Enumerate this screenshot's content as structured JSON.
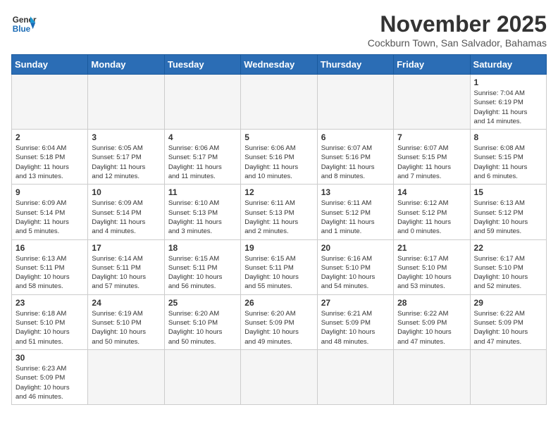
{
  "header": {
    "logo_line1": "General",
    "logo_line2": "Blue",
    "title": "November 2025",
    "subtitle": "Cockburn Town, San Salvador, Bahamas"
  },
  "days_of_week": [
    "Sunday",
    "Monday",
    "Tuesday",
    "Wednesday",
    "Thursday",
    "Friday",
    "Saturday"
  ],
  "weeks": [
    [
      {
        "day": "",
        "info": ""
      },
      {
        "day": "",
        "info": ""
      },
      {
        "day": "",
        "info": ""
      },
      {
        "day": "",
        "info": ""
      },
      {
        "day": "",
        "info": ""
      },
      {
        "day": "",
        "info": ""
      },
      {
        "day": "1",
        "info": "Sunrise: 7:04 AM\nSunset: 6:19 PM\nDaylight: 11 hours\nand 14 minutes."
      }
    ],
    [
      {
        "day": "2",
        "info": "Sunrise: 6:04 AM\nSunset: 5:18 PM\nDaylight: 11 hours\nand 13 minutes."
      },
      {
        "day": "3",
        "info": "Sunrise: 6:05 AM\nSunset: 5:17 PM\nDaylight: 11 hours\nand 12 minutes."
      },
      {
        "day": "4",
        "info": "Sunrise: 6:06 AM\nSunset: 5:17 PM\nDaylight: 11 hours\nand 11 minutes."
      },
      {
        "day": "5",
        "info": "Sunrise: 6:06 AM\nSunset: 5:16 PM\nDaylight: 11 hours\nand 10 minutes."
      },
      {
        "day": "6",
        "info": "Sunrise: 6:07 AM\nSunset: 5:16 PM\nDaylight: 11 hours\nand 8 minutes."
      },
      {
        "day": "7",
        "info": "Sunrise: 6:07 AM\nSunset: 5:15 PM\nDaylight: 11 hours\nand 7 minutes."
      },
      {
        "day": "8",
        "info": "Sunrise: 6:08 AM\nSunset: 5:15 PM\nDaylight: 11 hours\nand 6 minutes."
      }
    ],
    [
      {
        "day": "9",
        "info": "Sunrise: 6:09 AM\nSunset: 5:14 PM\nDaylight: 11 hours\nand 5 minutes."
      },
      {
        "day": "10",
        "info": "Sunrise: 6:09 AM\nSunset: 5:14 PM\nDaylight: 11 hours\nand 4 minutes."
      },
      {
        "day": "11",
        "info": "Sunrise: 6:10 AM\nSunset: 5:13 PM\nDaylight: 11 hours\nand 3 minutes."
      },
      {
        "day": "12",
        "info": "Sunrise: 6:11 AM\nSunset: 5:13 PM\nDaylight: 11 hours\nand 2 minutes."
      },
      {
        "day": "13",
        "info": "Sunrise: 6:11 AM\nSunset: 5:12 PM\nDaylight: 11 hours\nand 1 minute."
      },
      {
        "day": "14",
        "info": "Sunrise: 6:12 AM\nSunset: 5:12 PM\nDaylight: 11 hours\nand 0 minutes."
      },
      {
        "day": "15",
        "info": "Sunrise: 6:13 AM\nSunset: 5:12 PM\nDaylight: 10 hours\nand 59 minutes."
      }
    ],
    [
      {
        "day": "16",
        "info": "Sunrise: 6:13 AM\nSunset: 5:11 PM\nDaylight: 10 hours\nand 58 minutes."
      },
      {
        "day": "17",
        "info": "Sunrise: 6:14 AM\nSunset: 5:11 PM\nDaylight: 10 hours\nand 57 minutes."
      },
      {
        "day": "18",
        "info": "Sunrise: 6:15 AM\nSunset: 5:11 PM\nDaylight: 10 hours\nand 56 minutes."
      },
      {
        "day": "19",
        "info": "Sunrise: 6:15 AM\nSunset: 5:11 PM\nDaylight: 10 hours\nand 55 minutes."
      },
      {
        "day": "20",
        "info": "Sunrise: 6:16 AM\nSunset: 5:10 PM\nDaylight: 10 hours\nand 54 minutes."
      },
      {
        "day": "21",
        "info": "Sunrise: 6:17 AM\nSunset: 5:10 PM\nDaylight: 10 hours\nand 53 minutes."
      },
      {
        "day": "22",
        "info": "Sunrise: 6:17 AM\nSunset: 5:10 PM\nDaylight: 10 hours\nand 52 minutes."
      }
    ],
    [
      {
        "day": "23",
        "info": "Sunrise: 6:18 AM\nSunset: 5:10 PM\nDaylight: 10 hours\nand 51 minutes."
      },
      {
        "day": "24",
        "info": "Sunrise: 6:19 AM\nSunset: 5:10 PM\nDaylight: 10 hours\nand 50 minutes."
      },
      {
        "day": "25",
        "info": "Sunrise: 6:20 AM\nSunset: 5:10 PM\nDaylight: 10 hours\nand 50 minutes."
      },
      {
        "day": "26",
        "info": "Sunrise: 6:20 AM\nSunset: 5:09 PM\nDaylight: 10 hours\nand 49 minutes."
      },
      {
        "day": "27",
        "info": "Sunrise: 6:21 AM\nSunset: 5:09 PM\nDaylight: 10 hours\nand 48 minutes."
      },
      {
        "day": "28",
        "info": "Sunrise: 6:22 AM\nSunset: 5:09 PM\nDaylight: 10 hours\nand 47 minutes."
      },
      {
        "day": "29",
        "info": "Sunrise: 6:22 AM\nSunset: 5:09 PM\nDaylight: 10 hours\nand 47 minutes."
      }
    ],
    [
      {
        "day": "30",
        "info": "Sunrise: 6:23 AM\nSunset: 5:09 PM\nDaylight: 10 hours\nand 46 minutes."
      },
      {
        "day": "",
        "info": ""
      },
      {
        "day": "",
        "info": ""
      },
      {
        "day": "",
        "info": ""
      },
      {
        "day": "",
        "info": ""
      },
      {
        "day": "",
        "info": ""
      },
      {
        "day": "",
        "info": ""
      }
    ]
  ]
}
